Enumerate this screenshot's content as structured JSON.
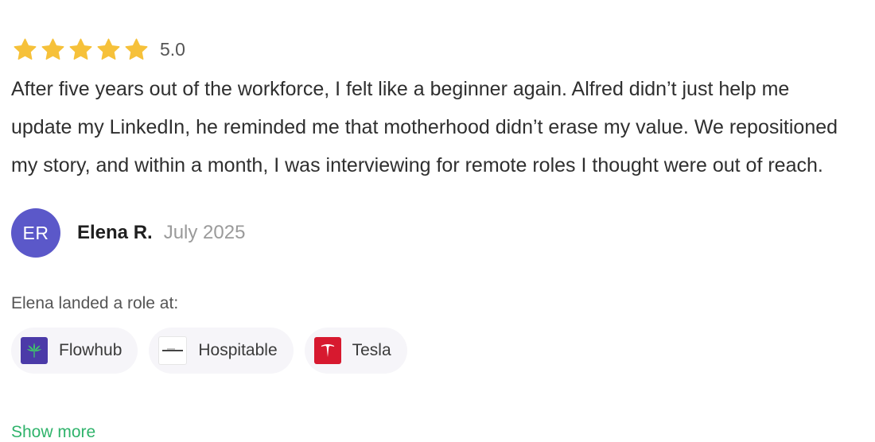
{
  "review": {
    "rating": 5,
    "rating_label": "5.0",
    "star_color": "#f6c13a",
    "text": "After five years out of the workforce, I felt like a beginner again. Alfred didn’t just help me update my LinkedIn, he reminded me that motherhood didn’t erase my value. We repositioned my story, and within a month, I was interviewing for remote roles I thought were out of reach.",
    "author": {
      "initials": "ER",
      "name": "Elena R.",
      "date": "July 2025",
      "avatar_color": "#5b58c9"
    },
    "landed_label": "Elena landed a role at:",
    "companies": [
      {
        "name": "Flowhub",
        "logo_icon": "cannabis-leaf-icon"
      },
      {
        "name": "Hospitable",
        "logo_icon": "hospitable-wordmark-icon"
      },
      {
        "name": "Tesla",
        "logo_icon": "tesla-t-icon"
      }
    ],
    "show_more_label": "Show more",
    "accent_color": "#2fb36b"
  }
}
